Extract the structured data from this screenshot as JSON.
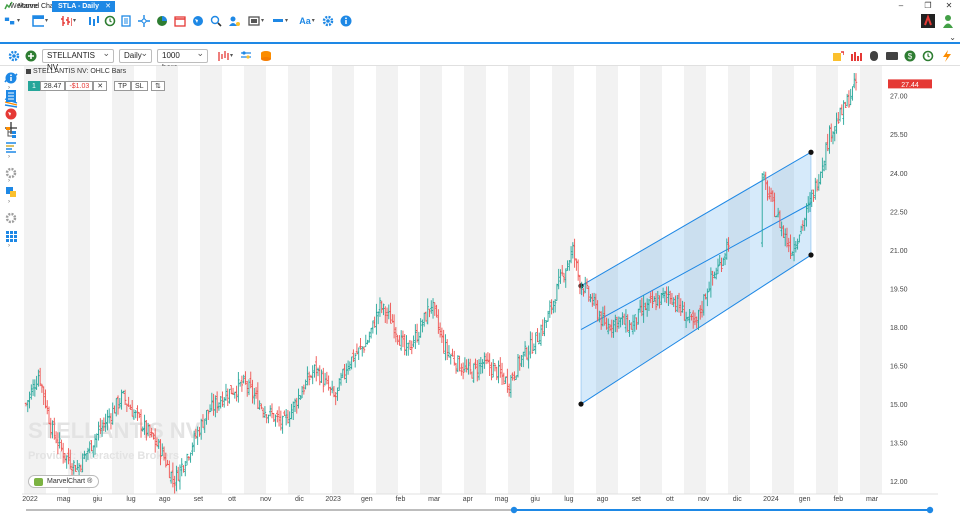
{
  "window": {
    "title": "Marvel Chart",
    "minimize": "–",
    "maximize": "❐",
    "close": "✕"
  },
  "tabs": [
    {
      "label": "Welcome"
    },
    {
      "label": "STLA - Daily",
      "close": "✕"
    }
  ],
  "toolbar2": {
    "symbol": "STELLANTIS NV",
    "timeframe": "Daily",
    "bars": "1000 bars"
  },
  "chart": {
    "header": "STELLANTIS NV: OHLC Bars",
    "order": {
      "qty": "1",
      "price": "28.47",
      "change": "-$1.03",
      "cancel": "✕",
      "tp": "TP",
      "sl": "SL",
      "flip": "⇅"
    },
    "last_price": "27.44",
    "watermark_name": "STELLANTIS NV",
    "watermark_provider": "Provider: Interactive Brokers",
    "badge": "MarvelChart ®"
  },
  "chart_data": {
    "type": "ohlc",
    "title": "STELLANTIS NV: OHLC Bars",
    "y_ticks": [
      "27.00",
      "25.50",
      "24.00",
      "22.50",
      "21.00",
      "19.50",
      "18.00",
      "16.50",
      "15.00",
      "13.50",
      "12.00"
    ],
    "ylim": [
      11.5,
      28.0
    ],
    "x_ticks": [
      "2022",
      "mag",
      "giu",
      "lug",
      "ago",
      "set",
      "ott",
      "nov",
      "dic",
      "2023",
      "gen",
      "feb",
      "mar",
      "apr",
      "mag",
      "giu",
      "lug",
      "ago",
      "set",
      "ott",
      "nov",
      "dic",
      "2024",
      "gen",
      "feb",
      "mar"
    ],
    "last_price": 27.44,
    "approx_close_path": [
      [
        0,
        15.0
      ],
      [
        4,
        16.2
      ],
      [
        8,
        14.0
      ],
      [
        12,
        13.0
      ],
      [
        16,
        12.5
      ],
      [
        22,
        13.8
      ],
      [
        30,
        15.3
      ],
      [
        36,
        14.2
      ],
      [
        42,
        13.2
      ],
      [
        46,
        12.0
      ],
      [
        50,
        13.0
      ],
      [
        56,
        14.6
      ],
      [
        62,
        15.4
      ],
      [
        68,
        15.8
      ],
      [
        74,
        14.8
      ],
      [
        80,
        14.2
      ],
      [
        86,
        15.6
      ],
      [
        90,
        16.4
      ],
      [
        96,
        15.2
      ],
      [
        100,
        16.6
      ],
      [
        106,
        17.4
      ],
      [
        110,
        18.8
      ],
      [
        114,
        18.2
      ],
      [
        118,
        17.0
      ],
      [
        122,
        17.8
      ],
      [
        126,
        18.9
      ],
      [
        130,
        17.2
      ],
      [
        134,
        16.6
      ],
      [
        138,
        16.2
      ],
      [
        142,
        16.6
      ],
      [
        146,
        16.3
      ],
      [
        150,
        15.8
      ],
      [
        154,
        16.8
      ],
      [
        158,
        17.4
      ],
      [
        162,
        18.3
      ],
      [
        166,
        19.8
      ],
      [
        170,
        21.0
      ],
      [
        172,
        19.8
      ],
      [
        176,
        19.0
      ],
      [
        180,
        18.0
      ],
      [
        184,
        18.3
      ],
      [
        188,
        18.0
      ],
      [
        192,
        18.7
      ],
      [
        196,
        19.0
      ],
      [
        200,
        19.3
      ],
      [
        204,
        18.6
      ],
      [
        208,
        18.0
      ],
      [
        212,
        19.6
      ],
      [
        216,
        20.5
      ],
      [
        220,
        22.0
      ],
      [
        224,
        23.2
      ],
      [
        228,
        24.0
      ],
      [
        232,
        22.8
      ],
      [
        236,
        21.5
      ],
      [
        238,
        21.0
      ],
      [
        242,
        22.2
      ],
      [
        246,
        23.7
      ],
      [
        250,
        25.6
      ],
      [
        254,
        26.4
      ],
      [
        258,
        27.5
      ]
    ],
    "channel": {
      "type": "linear_regression_channel",
      "start_date": "ago 2023",
      "end_date": "gen 2024",
      "upper": [
        19.6,
        24.8
      ],
      "middle": [
        17.9,
        22.8
      ],
      "lower": [
        15.0,
        20.8
      ]
    },
    "colors": {
      "bull": "#26a69a",
      "bear": "#ef5350",
      "channel": "#1e88e5",
      "weekend_band": "#f2f2f2",
      "last_price_tag": "#e53935"
    },
    "grid": false
  },
  "scrollbar": {
    "left_handle": "●",
    "right_handle": "●"
  }
}
